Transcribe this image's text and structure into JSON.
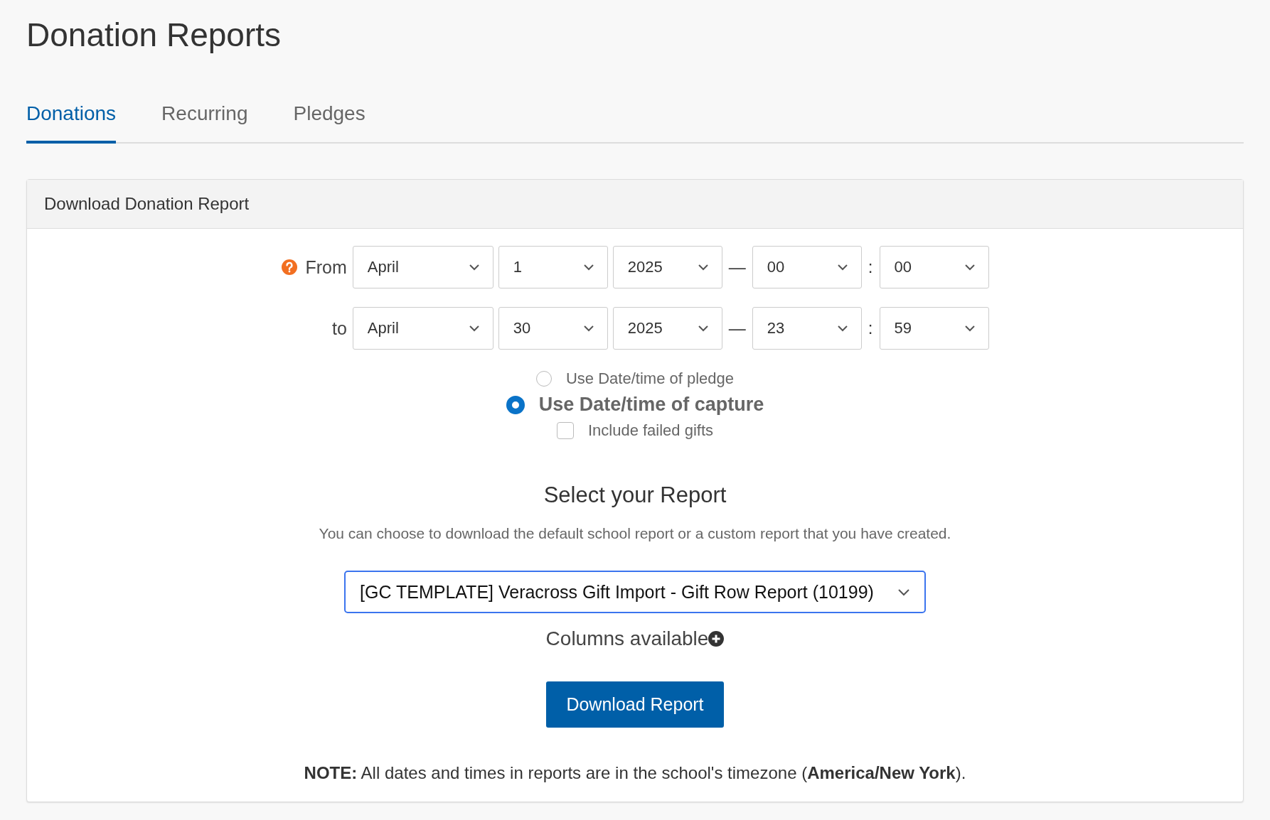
{
  "title": "Donation Reports",
  "tabs": [
    {
      "label": "Donations",
      "selected": true
    },
    {
      "label": "Recurring",
      "selected": false
    },
    {
      "label": "Pledges",
      "selected": false
    }
  ],
  "panel": {
    "heading": "Download Donation Report",
    "range_rows": [
      {
        "label": "From",
        "help": true,
        "fields": [
          {
            "kind": "wide-select",
            "value": "April"
          },
          {
            "kind": "select",
            "value": "1"
          },
          {
            "kind": "select",
            "value": "2025"
          },
          {
            "kind": "separator",
            "value": "—"
          },
          {
            "kind": "select",
            "value": "00"
          },
          {
            "kind": "separator",
            "value": ":"
          },
          {
            "kind": "select",
            "value": "00"
          }
        ]
      },
      {
        "label": "to",
        "help": false,
        "fields": [
          {
            "kind": "wide-select",
            "value": "April"
          },
          {
            "kind": "select",
            "value": "30"
          },
          {
            "kind": "select",
            "value": "2025"
          },
          {
            "kind": "separator",
            "value": "—"
          },
          {
            "kind": "select",
            "value": "23"
          },
          {
            "kind": "separator",
            "value": ":"
          },
          {
            "kind": "select",
            "value": "59"
          }
        ]
      }
    ],
    "date_basis": [
      {
        "label": "Use Date/time of pledge",
        "selected": false
      },
      {
        "label": "Use Date/time of capture",
        "selected": true
      }
    ],
    "failed_gifts": {
      "label": "Include failed gifts",
      "checked": false
    },
    "report_heading": "Select your Report",
    "report_description": "You can choose to download the default school report or a custom report that you have created.",
    "report_select": {
      "value": "[GC TEMPLATE] Veracross Gift Import - Gift Row Report (10199)",
      "focused": true
    },
    "columns_label": "Columns available",
    "download_button": "Download Report",
    "note": "**NOTE:** All dates and times in reports are in the school's timezone (**America/New York**)."
  }
}
